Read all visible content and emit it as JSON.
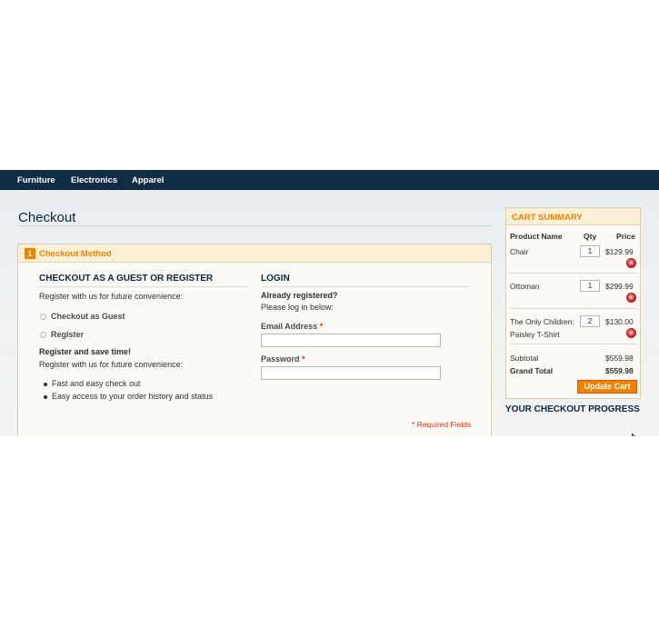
{
  "nav": {
    "items": [
      "Furniture",
      "Electronics",
      "Apparel"
    ]
  },
  "page": {
    "title": "Checkout"
  },
  "checkout_method": {
    "step": "1",
    "title": "Checkout Method",
    "guest": {
      "heading": "CHECKOUT AS A GUEST OR REGISTER",
      "intro": "Register with us for future convenience:",
      "options": [
        "Checkout as Guest",
        "Register"
      ],
      "save_heading": "Register and save time!",
      "save_intro": "Register with us for future convenience:",
      "benefits": [
        "Fast and easy check out",
        "Easy access to your order history and status"
      ]
    },
    "login": {
      "heading": "LOGIN",
      "already": "Already registered?",
      "please": "Please log in below:",
      "email_label": "Email Address",
      "password_label": "Password",
      "required_star": "*",
      "email_value": "",
      "password_value": ""
    },
    "required_note": "* Required Fields"
  },
  "cart_summary": {
    "title": "CART SUMMARY",
    "columns": [
      "Product Name",
      "Qty",
      "Price"
    ],
    "items": [
      {
        "name_line1": "Chair",
        "name_line2": "",
        "qty": "1",
        "price": "$129.99"
      },
      {
        "name_line1": "Ottoman",
        "name_line2": "",
        "qty": "1",
        "price": "$299.99"
      },
      {
        "name_line1": "The Only Children:",
        "name_line2": "Paisley T-Shirt",
        "qty": "2",
        "price": "$130.00"
      }
    ],
    "subtotal_label": "Subtotal",
    "subtotal_value": "$559.98",
    "grand_total_label": "Grand Total",
    "grand_total_value": "$559.98",
    "update_button": "Update Cart",
    "remove_icon": "remove-icon"
  },
  "progress": {
    "title": "YOUR CHECKOUT PROGRESS"
  },
  "colors": {
    "nav": "#112d45",
    "accent": "#f18200",
    "heading": "#0a263d",
    "required": "#eb340a"
  }
}
